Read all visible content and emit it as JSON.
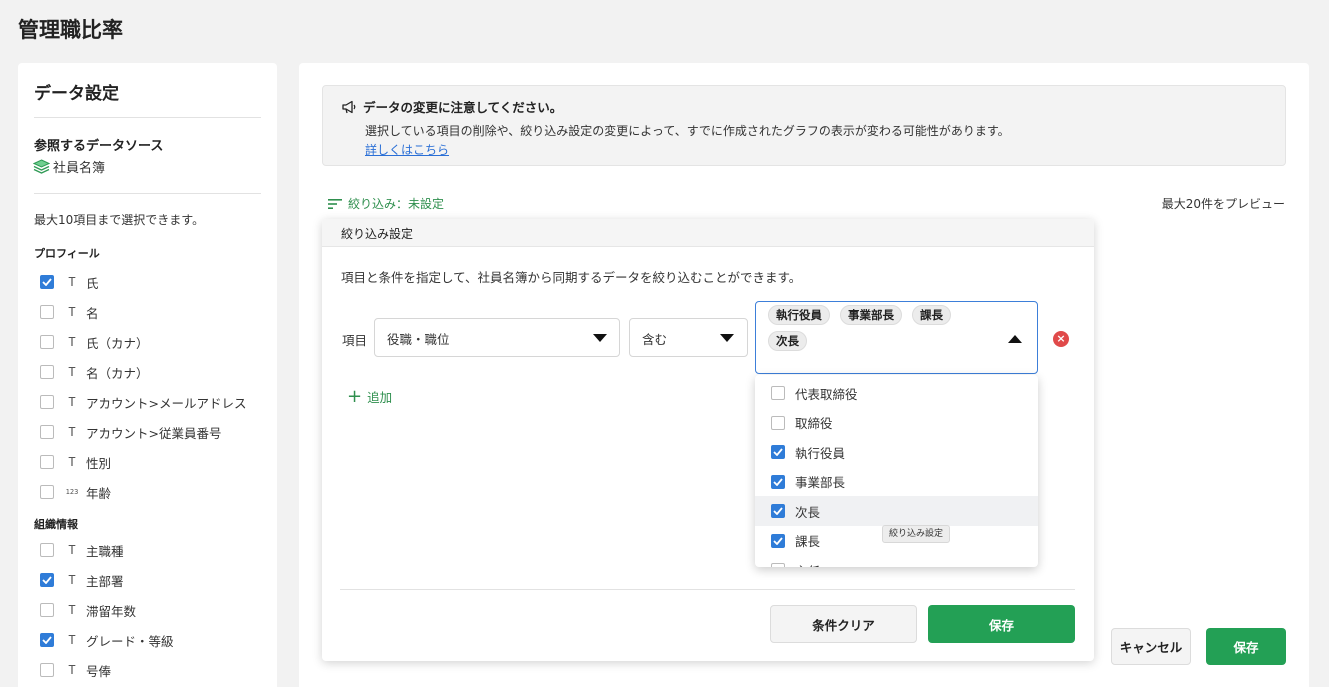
{
  "page": {
    "title": "管理職比率"
  },
  "sidebar": {
    "title": "データ設定",
    "source_label": "参照するデータソース",
    "source_name": "社員名簿",
    "max_note": "最大10項目まで選択できます。",
    "sections": [
      {
        "title": "プロフィール",
        "fields": [
          {
            "label": "氏",
            "type": "T",
            "checked": true
          },
          {
            "label": "名",
            "type": "T",
            "checked": false
          },
          {
            "label": "氏（カナ）",
            "type": "T",
            "checked": false
          },
          {
            "label": "名（カナ）",
            "type": "T",
            "checked": false
          },
          {
            "label": "アカウント>メールアドレス",
            "type": "T",
            "checked": false
          },
          {
            "label": "アカウント>従業員番号",
            "type": "T",
            "checked": false
          },
          {
            "label": "性別",
            "type": "T",
            "checked": false
          },
          {
            "label": "年齢",
            "type": "123",
            "checked": false
          }
        ]
      },
      {
        "title": "組織情報",
        "fields": [
          {
            "label": "主職種",
            "type": "T",
            "checked": false
          },
          {
            "label": "主部署",
            "type": "T",
            "checked": true
          },
          {
            "label": "滞留年数",
            "type": "T",
            "checked": false
          },
          {
            "label": "グレード・等級",
            "type": "T",
            "checked": true
          },
          {
            "label": "号俸",
            "type": "T",
            "checked": false
          }
        ]
      }
    ]
  },
  "notice": {
    "title": "データの変更に注意してください。",
    "body": "選択している項目の削除や、絞り込み設定の変更によって、すでに作成されたグラフの表示が変わる可能性があります。",
    "link": "詳しくはこちら"
  },
  "filter_bar": {
    "label": "絞り込み：未設定",
    "preview": "最大20件をプレビュー"
  },
  "dialog": {
    "title": "絞り込み設定",
    "description": "項目と条件を指定して、社員名簿から同期するデータを絞り込むことができます。",
    "item_label": "項目",
    "field_value": "役職・職位",
    "operator_value": "含む",
    "chips": [
      "執行役員",
      "事業部長",
      "課長",
      "次長"
    ],
    "add_label": "追加",
    "clear_button": "条件クリア",
    "save_button": "保存"
  },
  "dropdown": {
    "options": [
      {
        "label": "代表取締役",
        "checked": false
      },
      {
        "label": "取締役",
        "checked": false
      },
      {
        "label": "執行役員",
        "checked": true
      },
      {
        "label": "事業部長",
        "checked": true
      },
      {
        "label": "次長",
        "checked": true,
        "hover": true
      },
      {
        "label": "課長",
        "checked": true
      },
      {
        "label": "主任",
        "checked": false
      }
    ],
    "tooltip": "絞り込み設定"
  },
  "footer": {
    "cancel_button": "キャンセル",
    "save_button": "保存"
  },
  "colors": {
    "accent_green": "#23a055",
    "checkbox_blue": "#2f7cd8",
    "link_blue": "#2a6fd6",
    "error_red": "#e04a4a"
  }
}
